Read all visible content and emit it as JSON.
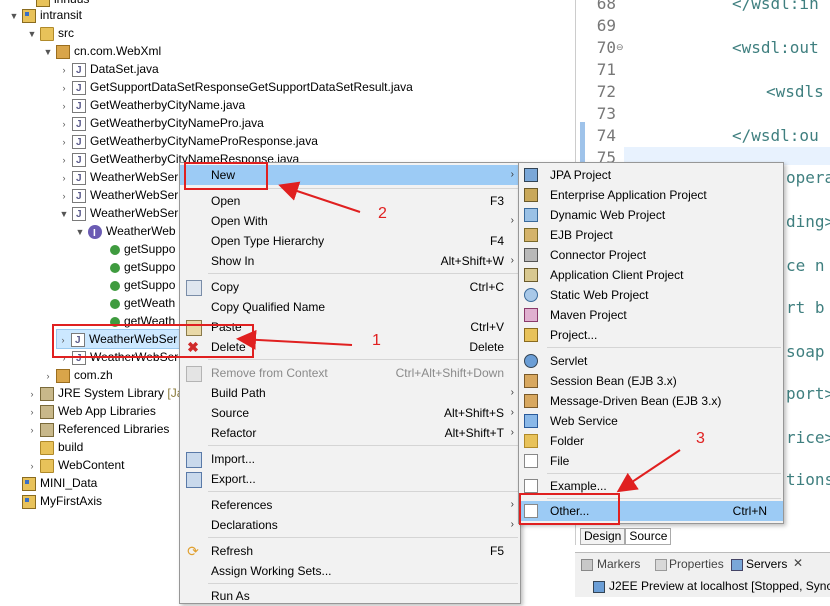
{
  "tree": {
    "top_partial": "innuus",
    "project": "intransit",
    "src": "src",
    "package": "cn.com.WebXml",
    "files": [
      "DataSet.java",
      "GetSupportDataSetResponseGetSupportDataSetResult.java",
      "GetWeatherbyCityName.java",
      "GetWeatherbyCityNamePro.java",
      "GetWeatherbyCityNameProResponse.java",
      "GetWeatherbyCityNameResponse.java",
      "WeatherWebSer",
      "WeatherWebSer",
      "WeatherWebSer"
    ],
    "interface_name": "WeatherWeb",
    "methods": [
      "getSuppo",
      "getSuppo",
      "getSuppo",
      "getWeath",
      "getWeath"
    ],
    "selected_file": "WeatherWebSer",
    "after_selected": "WeatherWebSer",
    "package2": "com.zh",
    "jre": "JRE System Library",
    "jre_suffix": "[Jav",
    "web_app_libs": "Web App Libraries",
    "ref_libs": "Referenced Libraries",
    "build": "build",
    "web_content": "WebContent",
    "mini_data": "MINI_Data",
    "my_first_axis": "MyFirstAxis"
  },
  "editor": {
    "lines": [
      {
        "n": "68",
        "code": "</wsdl:in"
      },
      {
        "n": "69",
        "code": ""
      },
      {
        "n": "70",
        "code": "<wsdl:out"
      },
      {
        "n": "71",
        "code": ""
      },
      {
        "n": "72",
        "code": "<wsdls"
      },
      {
        "n": "73",
        "code": ""
      },
      {
        "n": "74",
        "code": "</wsdl:ou"
      },
      {
        "n": "75",
        "code": ""
      }
    ],
    "obscured": [
      "opera",
      "ding>",
      "ce n",
      "rt b",
      "soap",
      "port>",
      "rice>",
      "tions"
    ],
    "tabs": {
      "design": "Design",
      "source": "Source"
    },
    "bottom_tabs": {
      "markers": "Markers",
      "properties": "Properties",
      "servers": "Servers"
    },
    "server_row": "J2EE Preview at localhost  [Stopped, Sync"
  },
  "context_menu": {
    "items": [
      {
        "label": "New",
        "shortcut": "",
        "submenu": true
      },
      {
        "label": "Open",
        "shortcut": "F3"
      },
      {
        "label": "Open With",
        "shortcut": "",
        "submenu": true
      },
      {
        "label": "Open Type Hierarchy",
        "shortcut": "F4"
      },
      {
        "label": "Show In",
        "shortcut": "Alt+Shift+W",
        "submenu": true
      },
      {
        "label": "Copy",
        "shortcut": "Ctrl+C"
      },
      {
        "label": "Copy Qualified Name",
        "shortcut": ""
      },
      {
        "label": "Paste",
        "shortcut": "Ctrl+V"
      },
      {
        "label": "Delete",
        "shortcut": "Delete"
      },
      {
        "label": "Remove from Context",
        "shortcut": "Ctrl+Alt+Shift+Down"
      },
      {
        "label": "Build Path",
        "shortcut": "",
        "submenu": true
      },
      {
        "label": "Source",
        "shortcut": "Alt+Shift+S",
        "submenu": true
      },
      {
        "label": "Refactor",
        "shortcut": "Alt+Shift+T",
        "submenu": true
      },
      {
        "label": "Import...",
        "shortcut": ""
      },
      {
        "label": "Export...",
        "shortcut": ""
      },
      {
        "label": "References",
        "shortcut": "",
        "submenu": true
      },
      {
        "label": "Declarations",
        "shortcut": "",
        "submenu": true
      },
      {
        "label": "Refresh",
        "shortcut": "F5"
      },
      {
        "label": "Assign Working Sets...",
        "shortcut": ""
      },
      {
        "label": "Run As",
        "shortcut": ""
      }
    ]
  },
  "new_submenu": {
    "items": [
      {
        "label": "JPA Project",
        "shortcut": ""
      },
      {
        "label": "Enterprise Application Project",
        "shortcut": ""
      },
      {
        "label": "Dynamic Web Project",
        "shortcut": ""
      },
      {
        "label": "EJB Project",
        "shortcut": ""
      },
      {
        "label": "Connector Project",
        "shortcut": ""
      },
      {
        "label": "Application Client Project",
        "shortcut": ""
      },
      {
        "label": "Static Web Project",
        "shortcut": ""
      },
      {
        "label": "Maven Project",
        "shortcut": ""
      },
      {
        "label": "Project...",
        "shortcut": ""
      },
      {
        "label": "Servlet",
        "shortcut": ""
      },
      {
        "label": "Session Bean (EJB 3.x)",
        "shortcut": ""
      },
      {
        "label": "Message-Driven Bean (EJB 3.x)",
        "shortcut": ""
      },
      {
        "label": "Web Service",
        "shortcut": ""
      },
      {
        "label": "Folder",
        "shortcut": ""
      },
      {
        "label": "File",
        "shortcut": ""
      },
      {
        "label": "Example...",
        "shortcut": ""
      },
      {
        "label": "Other...",
        "shortcut": "Ctrl+N"
      }
    ]
  },
  "annotations": {
    "n1": "1",
    "n2": "2",
    "n3": "3"
  },
  "colors": {
    "highlight": "#9ccbf5",
    "annotation": "#e02020",
    "selection": "#cce8ff"
  }
}
